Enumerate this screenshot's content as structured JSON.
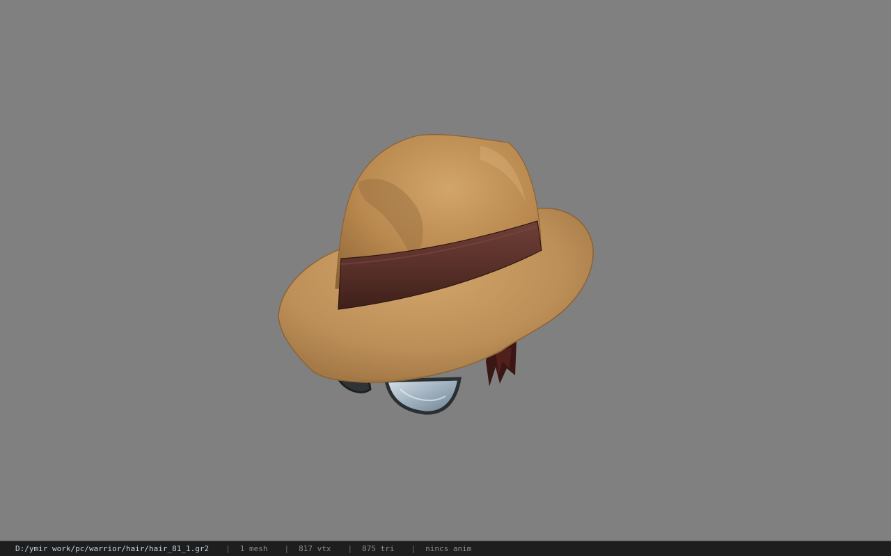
{
  "viewport": {
    "background": "#808080",
    "model": "hat-with-glasses-and-hair"
  },
  "statusbar": {
    "file_path": "D:/ymir work/pc/warrior/hair/hair_81_1.gr2",
    "separator": "|",
    "mesh_count": "1 mesh",
    "vertex_count": "817 vtx",
    "triangle_count": "875 tri",
    "anim_status": "nincs anim"
  }
}
